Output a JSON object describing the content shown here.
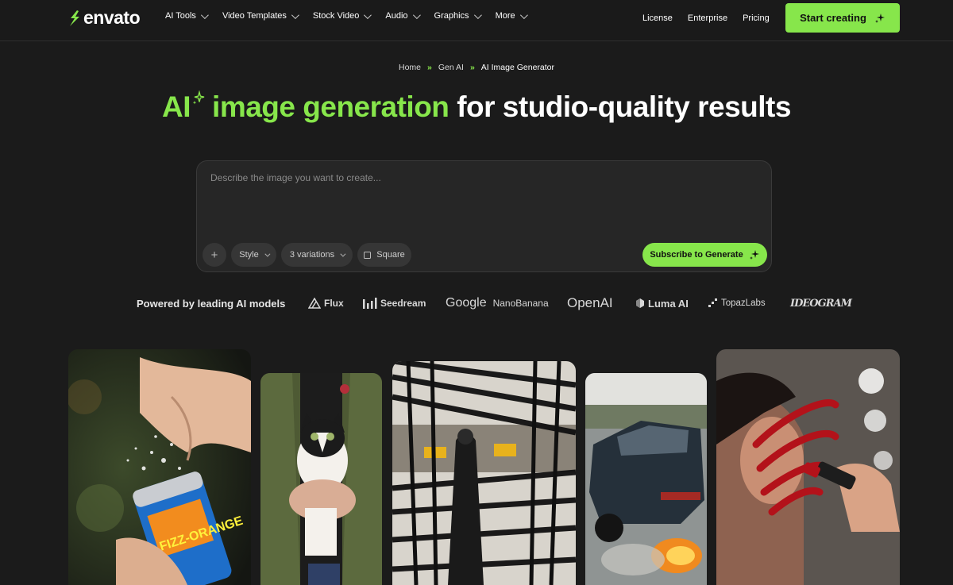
{
  "brand": {
    "name": "envato",
    "color": "#87e64b"
  },
  "nav": {
    "items": [
      {
        "label": "AI Tools"
      },
      {
        "label": "Video Templates"
      },
      {
        "label": "Stock Video"
      },
      {
        "label": "Audio"
      },
      {
        "label": "Graphics"
      },
      {
        "label": "More"
      }
    ],
    "links": [
      {
        "label": "License"
      },
      {
        "label": "Enterprise"
      },
      {
        "label": "Pricing"
      }
    ],
    "cta_label": "Start creating"
  },
  "breadcrumb": {
    "items": [
      "Home",
      "Gen AI",
      "AI Image Generator"
    ],
    "separator": "»"
  },
  "hero": {
    "title_green": "AI",
    "title_green2": "image generation",
    "title_white": "for studio-quality results"
  },
  "prompt": {
    "placeholder": "Describe the image you want to create...",
    "value": "",
    "add_label": "+",
    "style_label": "Style",
    "variations_label": "3 variations",
    "aspect_label": "Square",
    "generate_label": "Subscribe to Generate"
  },
  "models": {
    "label": "Powered by leading AI models",
    "list": [
      {
        "name": "Flux",
        "icon": "flux-icon"
      },
      {
        "name": "Seedream",
        "icon": "seedream-icon"
      },
      {
        "name": "Google",
        "sub": "NanoBanana"
      },
      {
        "name": "OpenAI"
      },
      {
        "name": "Luma AI",
        "icon": "luma-icon"
      },
      {
        "name": "TopazLabs",
        "icon": "topaz-icon"
      },
      {
        "name": "IDEOGRAM"
      }
    ]
  },
  "gallery": {
    "images": [
      {
        "name": "soda-can-opening",
        "can_text": "FIZZ-ORANGE"
      },
      {
        "name": "cat-in-arms"
      },
      {
        "name": "city-street-shadows"
      },
      {
        "name": "muscle-car-burnout"
      },
      {
        "name": "red-lipstick-mirror"
      }
    ]
  },
  "colors": {
    "accent": "#87e64b",
    "background": "#1b1b1b",
    "surface": "#262626",
    "chip": "#363636"
  }
}
